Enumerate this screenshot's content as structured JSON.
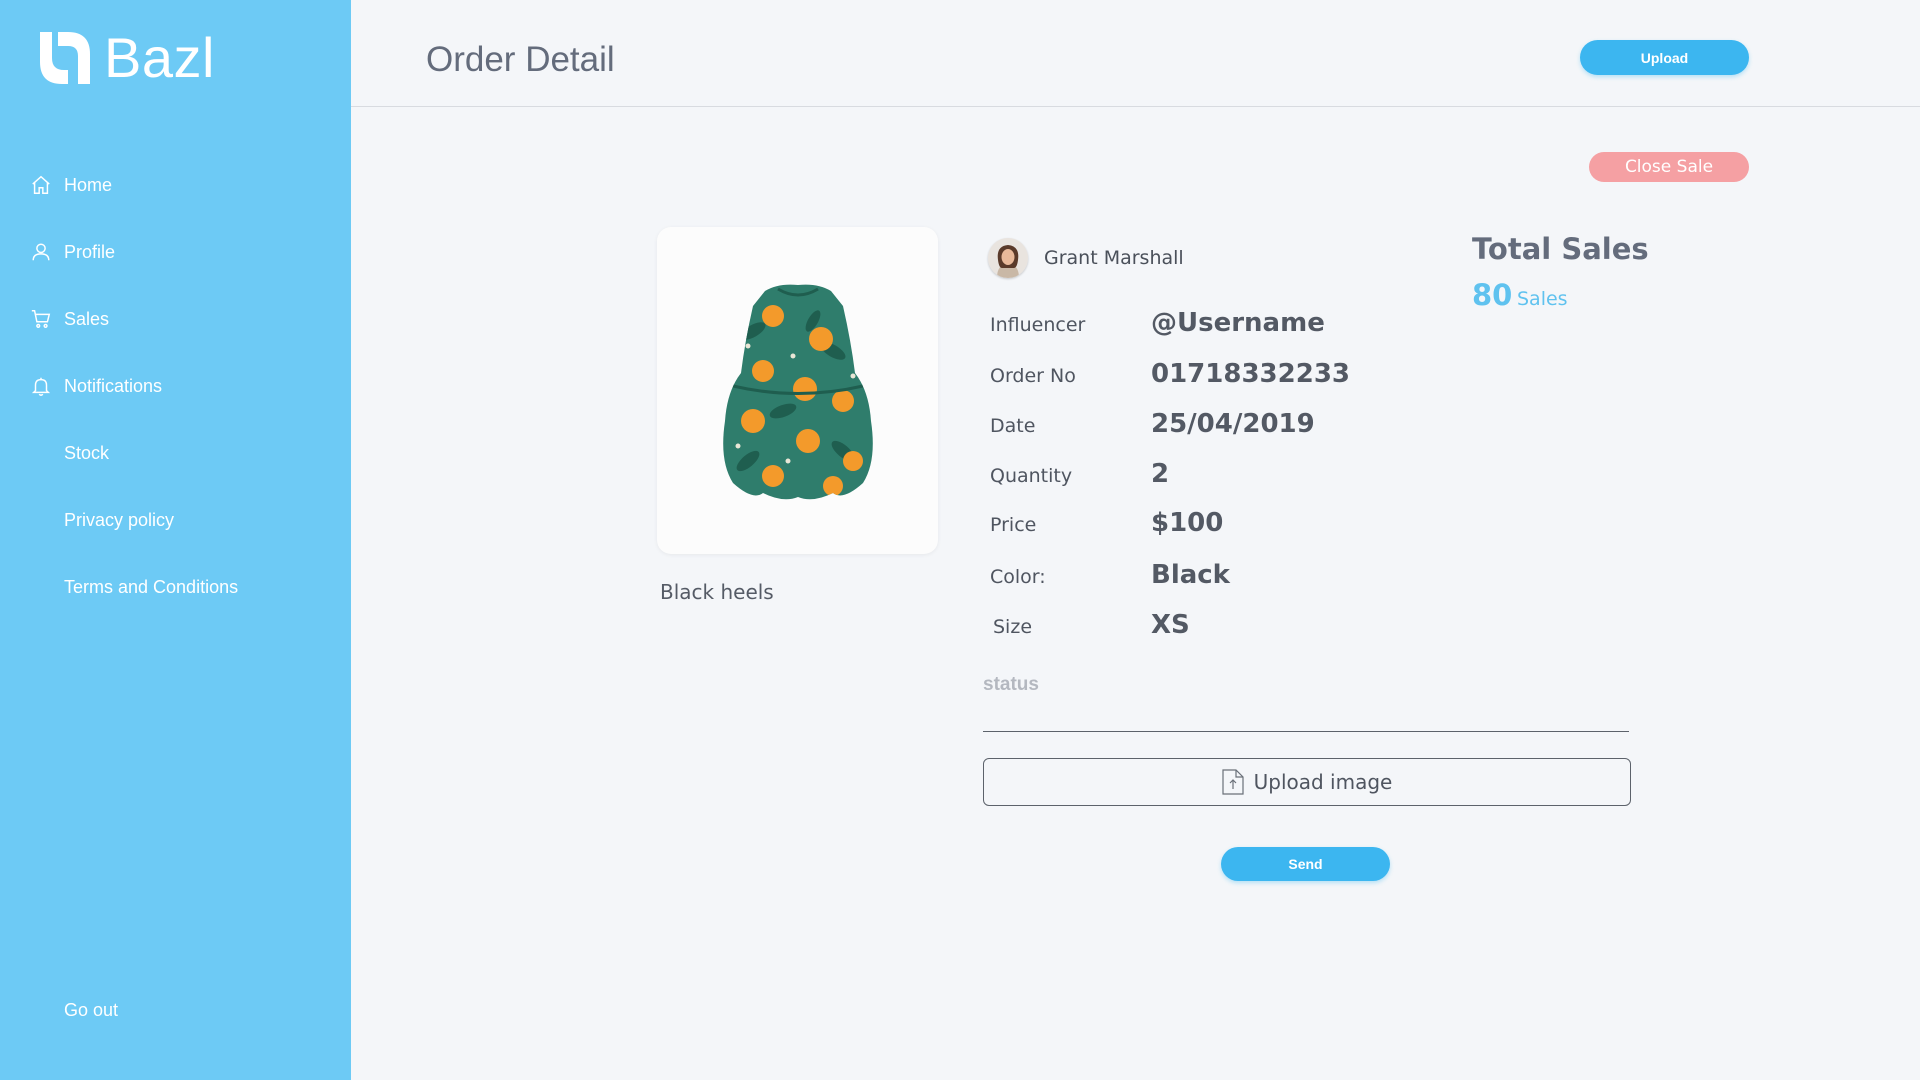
{
  "brand": {
    "name": "Bazl",
    "icon": "bazl-logo-icon"
  },
  "sidebar": {
    "items": [
      {
        "label": "Home",
        "icon": "home-icon"
      },
      {
        "label": "Profile",
        "icon": "user-icon"
      },
      {
        "label": "Sales",
        "icon": "cart-icon"
      },
      {
        "label": "Notifications",
        "icon": "bell-icon"
      },
      {
        "label": "Stock"
      },
      {
        "label": "Privacy policy"
      },
      {
        "label": "Terms and Conditions"
      }
    ],
    "go_out": "Go out"
  },
  "header": {
    "title": "Order Detail",
    "upload_label": "Upload"
  },
  "close_sale_label": "Close Sale",
  "product": {
    "name": "Black heels"
  },
  "seller": {
    "name": "Grant Marshall"
  },
  "details": [
    {
      "label": "Influencer",
      "value": "@Username"
    },
    {
      "label": "Order No",
      "value": "01718332233"
    },
    {
      "label": "Date",
      "value": "25/04/2019"
    },
    {
      "label": "Quantity",
      "value": "2"
    },
    {
      "label": "Price",
      "value": "$100"
    },
    {
      "label": "Color:",
      "value": "Black"
    },
    {
      "label": "Size",
      "value": "XS"
    }
  ],
  "total_sales": {
    "title": "Total Sales",
    "count": "80",
    "unit": "Sales"
  },
  "status": {
    "label": "status",
    "value": ""
  },
  "upload_image_label": "Upload image",
  "send_label": "Send",
  "colors": {
    "sidebar": "#6dcaf5",
    "primary": "#3cb6f0",
    "danger": "#f5a0a3",
    "background": "#f4f6f9"
  }
}
